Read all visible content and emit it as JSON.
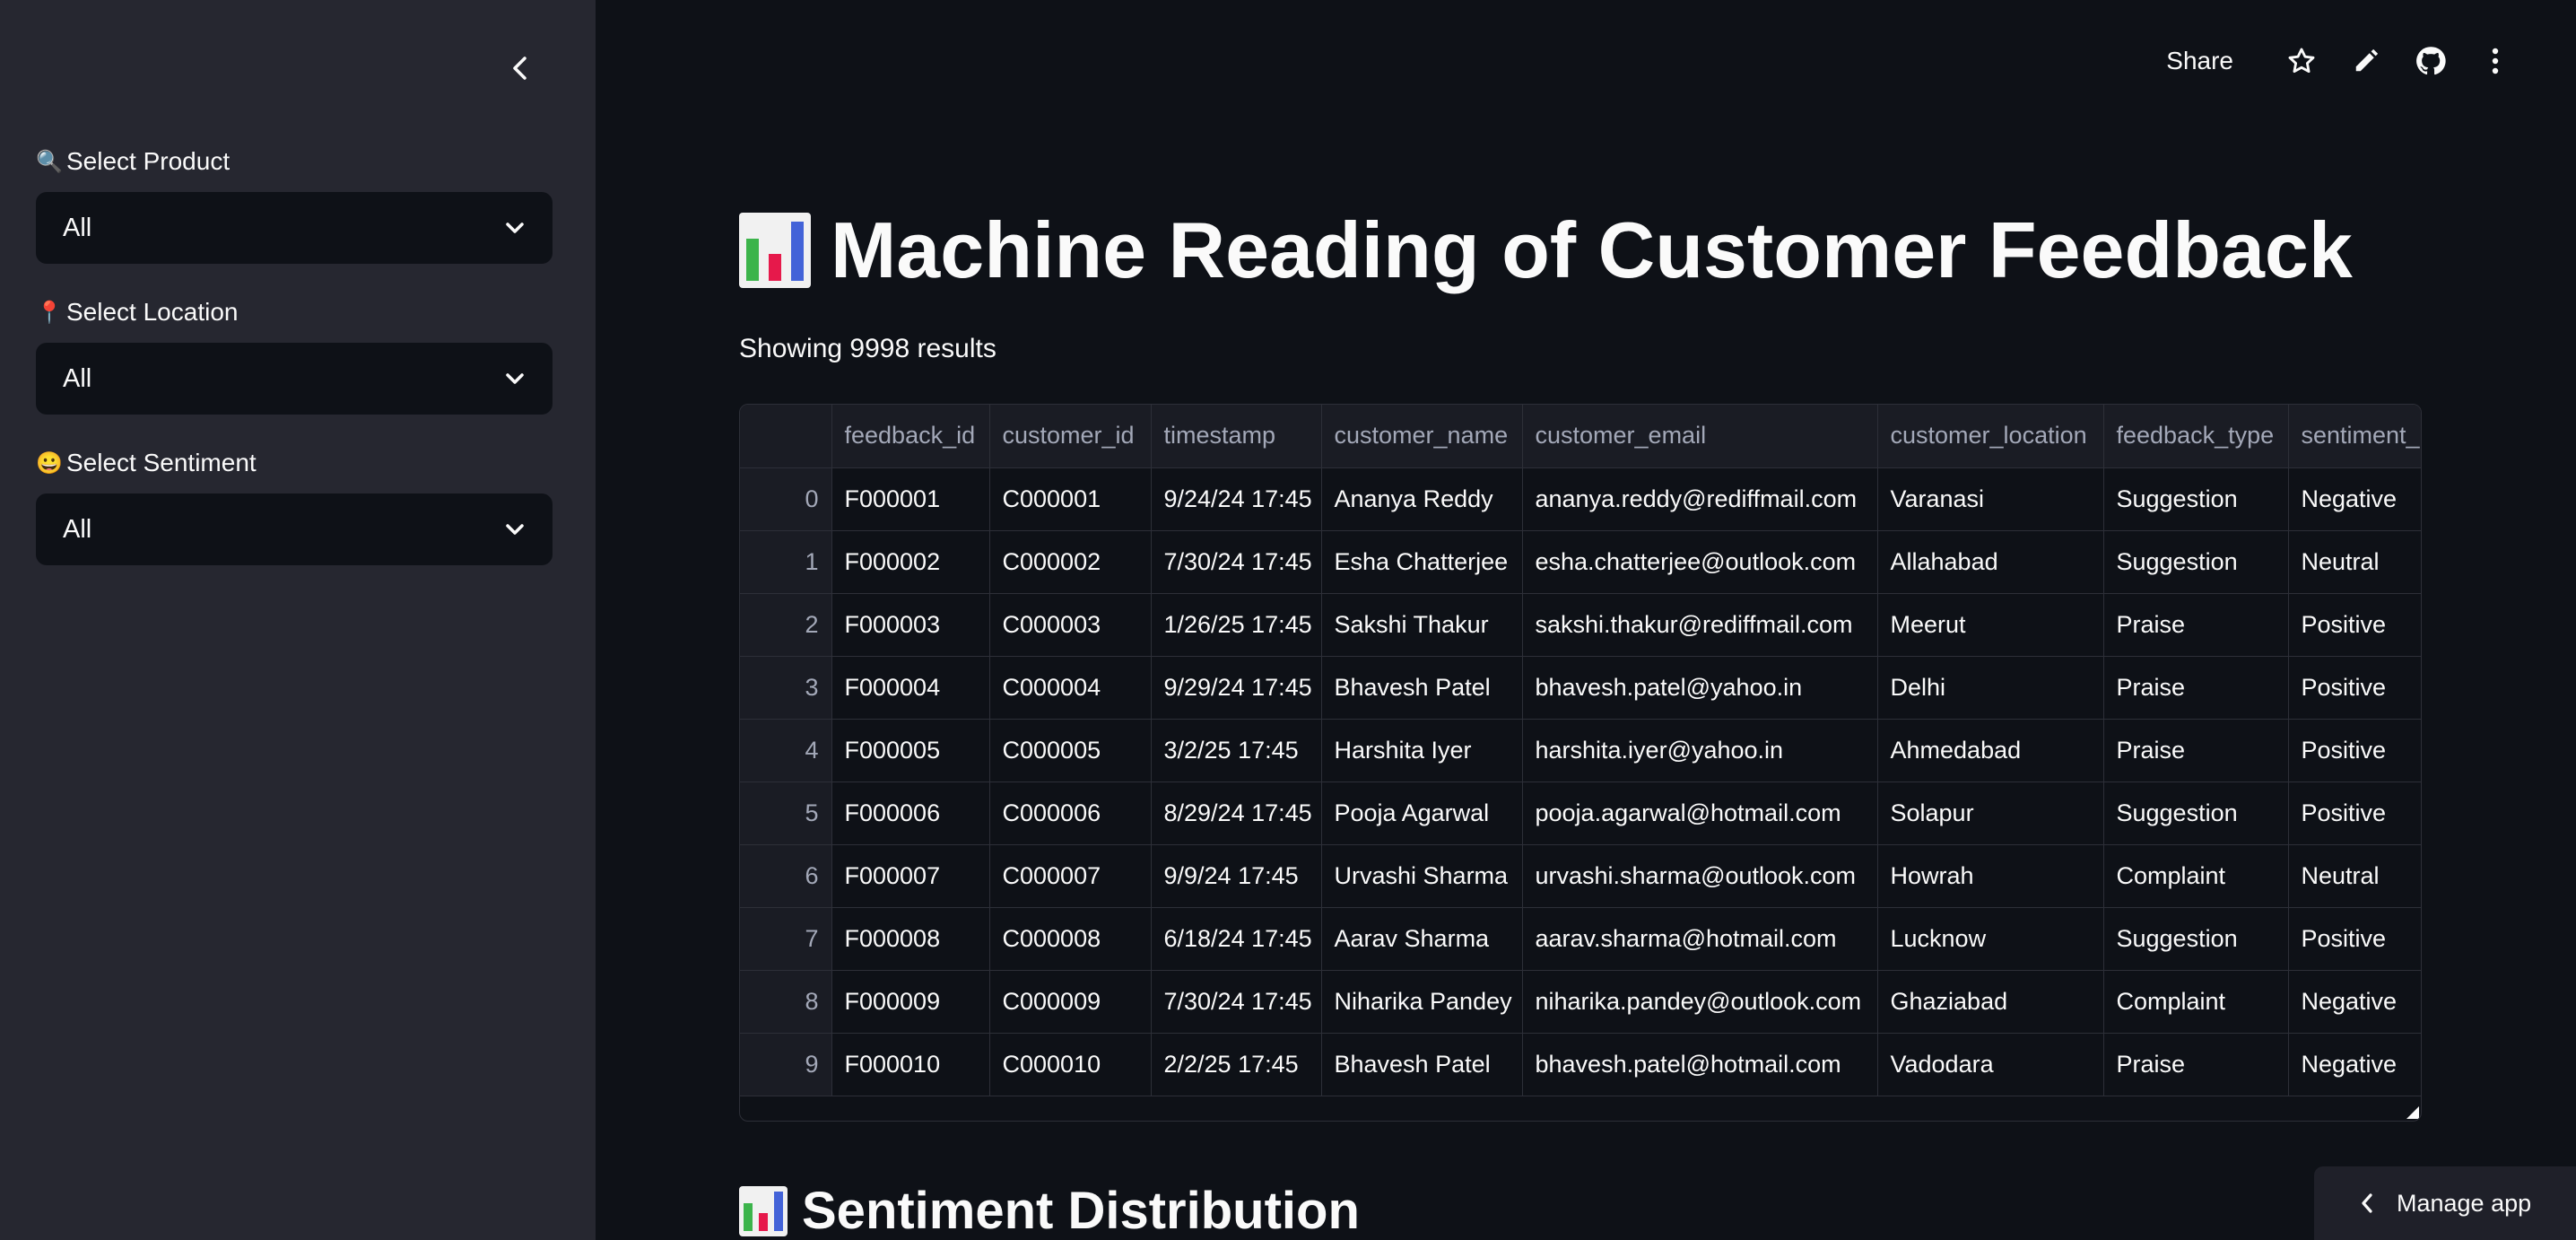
{
  "sidebar": {
    "filters": [
      {
        "icon": "🔍",
        "label": "Select Product",
        "value": "All"
      },
      {
        "icon": "📍",
        "label": "Select Location",
        "value": "All"
      },
      {
        "icon": "😀",
        "label": "Select Sentiment",
        "value": "All"
      }
    ]
  },
  "header": {
    "share_label": "Share"
  },
  "main": {
    "title": "Machine Reading of Customer Feedback",
    "result_count": "Showing 9998 results",
    "section_title": "Sentiment Distribution"
  },
  "table": {
    "columns": [
      "",
      "feedback_id",
      "customer_id",
      "timestamp",
      "customer_name",
      "customer_email",
      "customer_location",
      "feedback_type",
      "sentiment_"
    ],
    "rows": [
      [
        "0",
        "F000001",
        "C000001",
        "9/24/24 17:45",
        "Ananya Reddy",
        "ananya.reddy@rediffmail.com",
        "Varanasi",
        "Suggestion",
        "Negative"
      ],
      [
        "1",
        "F000002",
        "C000002",
        "7/30/24 17:45",
        "Esha Chatterjee",
        "esha.chatterjee@outlook.com",
        "Allahabad",
        "Suggestion",
        "Neutral"
      ],
      [
        "2",
        "F000003",
        "C000003",
        "1/26/25 17:45",
        "Sakshi Thakur",
        "sakshi.thakur@rediffmail.com",
        "Meerut",
        "Praise",
        "Positive"
      ],
      [
        "3",
        "F000004",
        "C000004",
        "9/29/24 17:45",
        "Bhavesh Patel",
        "bhavesh.patel@yahoo.in",
        "Delhi",
        "Praise",
        "Positive"
      ],
      [
        "4",
        "F000005",
        "C000005",
        "3/2/25 17:45",
        "Harshita Iyer",
        "harshita.iyer@yahoo.in",
        "Ahmedabad",
        "Praise",
        "Positive"
      ],
      [
        "5",
        "F000006",
        "C000006",
        "8/29/24 17:45",
        "Pooja Agarwal",
        "pooja.agarwal@hotmail.com",
        "Solapur",
        "Suggestion",
        "Positive"
      ],
      [
        "6",
        "F000007",
        "C000007",
        "9/9/24 17:45",
        "Urvashi Sharma",
        "urvashi.sharma@outlook.com",
        "Howrah",
        "Complaint",
        "Neutral"
      ],
      [
        "7",
        "F000008",
        "C000008",
        "6/18/24 17:45",
        "Aarav Sharma",
        "aarav.sharma@hotmail.com",
        "Lucknow",
        "Suggestion",
        "Positive"
      ],
      [
        "8",
        "F000009",
        "C000009",
        "7/30/24 17:45",
        "Niharika Pandey",
        "niharika.pandey@outlook.com",
        "Ghaziabad",
        "Complaint",
        "Negative"
      ],
      [
        "9",
        "F000010",
        "C000010",
        "2/2/25 17:45",
        "Bhavesh Patel",
        "bhavesh.patel@hotmail.com",
        "Vadodara",
        "Praise",
        "Negative"
      ]
    ]
  },
  "manage_app": {
    "label": "Manage app"
  },
  "colors": {
    "sidebar_bg": "#262730",
    "main_bg": "#0e1117",
    "select_bg": "#0e1117",
    "text": "#fafafa",
    "muted": "#a3a8b8"
  }
}
